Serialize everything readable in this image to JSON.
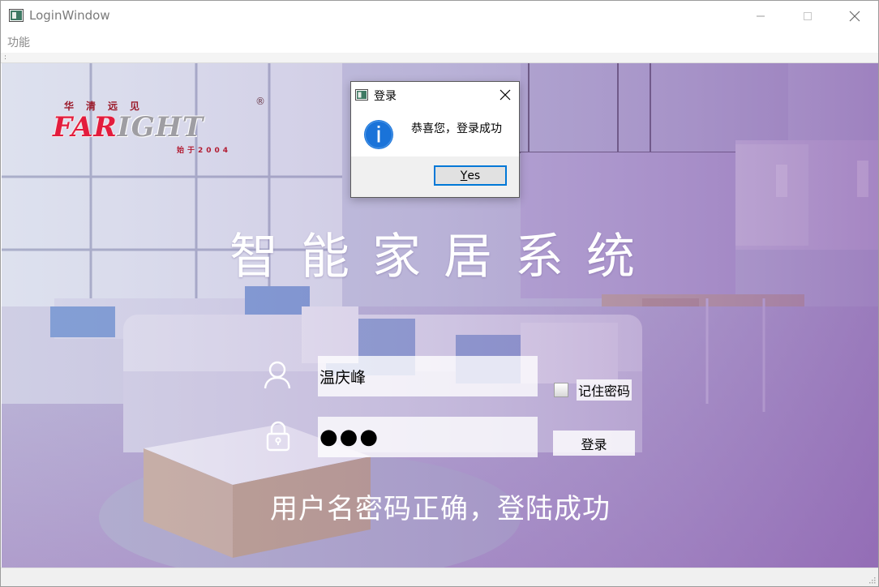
{
  "window": {
    "title": "LoginWindow",
    "controls": {
      "minimize": "minimize-icon",
      "maximize": "maximize-icon",
      "close": "close-icon"
    }
  },
  "menubar": {
    "items": [
      {
        "label": "功能"
      }
    ]
  },
  "toolbar": {
    "handle": ":"
  },
  "logo": {
    "chinese": "华清远见",
    "word_part1": "FAR",
    "word_part2": "IGHT",
    "registered": "®",
    "since": "始于2004",
    "colors": {
      "red": "#e31c3d",
      "gray": "#9f9ea3"
    }
  },
  "main": {
    "title": "智能家居系统",
    "username_value": "温庆峰",
    "password_value": "●●●",
    "remember_label": "记住密码",
    "remember_checked": false,
    "login_button": "登录",
    "status_message": "用户名密码正确，登陆成功"
  },
  "dialog": {
    "title": "登录",
    "message": "恭喜您，登录成功",
    "button_prefix": "Y",
    "button_rest": "es",
    "accent": "#0078d7"
  },
  "colors": {
    "overlay_purple": "#8e63b3",
    "info_blue": "#1a73d9"
  }
}
